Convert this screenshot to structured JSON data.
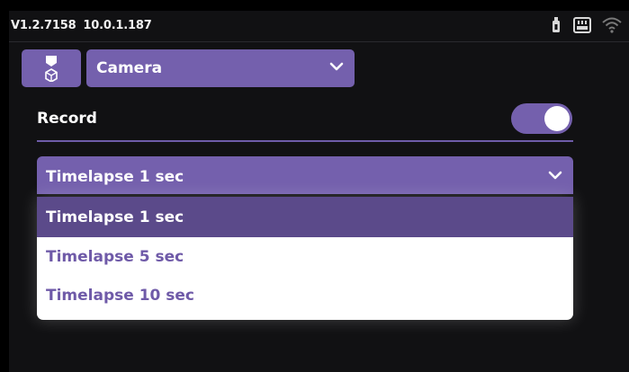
{
  "status": {
    "version": "V1.2.7158",
    "ip": "10.0.1.187",
    "icons": [
      "usb-icon",
      "sd-card-icon",
      "wifi-icon"
    ]
  },
  "source_select": {
    "selected": "Camera",
    "icon": "chevron-down-icon"
  },
  "model_button": {
    "icon": "printer-model-icon"
  },
  "record": {
    "label": "Record",
    "enabled": true
  },
  "timelapse_select": {
    "selected": "Timelapse 1 sec",
    "options": [
      "Timelapse 1 sec",
      "Timelapse 5 sec",
      "Timelapse 10 sec"
    ]
  },
  "colors": {
    "accent": "#7460ad",
    "selected_option": "#5b4a8a",
    "option_text": "#6f5aa8",
    "background": "#111113"
  }
}
